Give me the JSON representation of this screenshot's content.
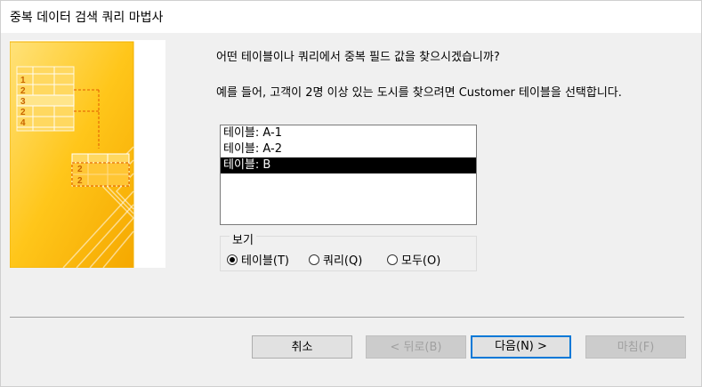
{
  "window": {
    "title": "중복 데이터 검색 쿼리 마법사"
  },
  "prompt": {
    "question": "어떤 테이블이나 쿼리에서 중복 필드 값을 찾으시겠습니까?",
    "example": "예를 들어, 고객이 2명 이상 있는 도시를 찾으려면 Customer 테이블을 선택합니다."
  },
  "list": {
    "items": [
      "테이블: A-1",
      "테이블: A-2",
      "테이블: B"
    ],
    "selected_index": 2
  },
  "view": {
    "legend": "보기",
    "options": [
      {
        "label": "테이블(T)",
        "checked": true
      },
      {
        "label": "쿼리(Q)",
        "checked": false
      },
      {
        "label": "모두(O)",
        "checked": false
      }
    ]
  },
  "buttons": {
    "cancel": "취소",
    "back": "< 뒤로(B)",
    "next": "다음(N) >",
    "finish": "마침(F)"
  },
  "illustration": {
    "row_numbers_top": [
      "1",
      "2",
      "3",
      "2",
      "4"
    ],
    "row_numbers_bottom": [
      "2",
      "2"
    ]
  },
  "colors": {
    "accent": "#0078d7",
    "illustration_yellow": "#ffc61a",
    "illustration_orange": "#f2a900",
    "selection": "#000000"
  }
}
